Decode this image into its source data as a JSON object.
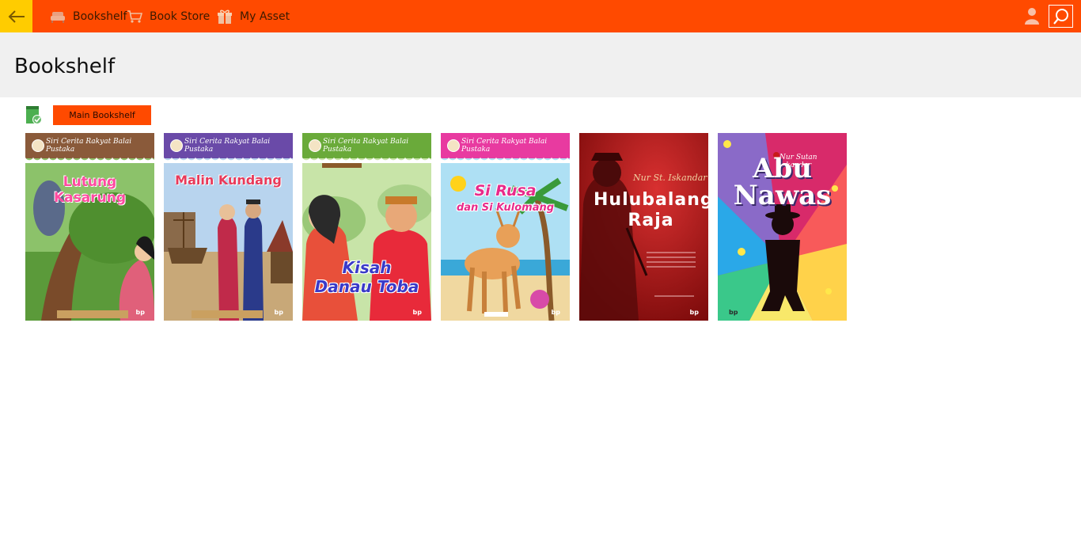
{
  "nav": {
    "bookshelf": "Bookshelf",
    "book_store": "Book Store",
    "my_asset": "My Asset"
  },
  "page_title": "Bookshelf",
  "shelf_button": "Main Bookshelf",
  "series_label": "Siri Cerita Rakyat Balai Pustaka",
  "books": [
    {
      "title": "Lutung Kasarung"
    },
    {
      "title": "Malin Kundang"
    },
    {
      "title_line1": "Kisah",
      "title_line2": "Danau Toba"
    },
    {
      "title_line1": "Si Rusa",
      "title_line2": "dan Si Kulomang"
    },
    {
      "author": "Nur St. Iskandar",
      "title_line1": "Hulubalang",
      "title_line2": "Raja"
    },
    {
      "author": "Nur Sutan Iskandar",
      "title_line1": "Abu",
      "title_line2": "Nawas"
    }
  ],
  "colors": {
    "topbar": "#ff4a00",
    "back": "#ffcc00",
    "titlebar": "#f0f0f0"
  },
  "icons": [
    "back-arrow-icon",
    "sofa-icon",
    "cart-icon",
    "gift-icon",
    "user-icon",
    "search-icon",
    "book-check-icon"
  ]
}
